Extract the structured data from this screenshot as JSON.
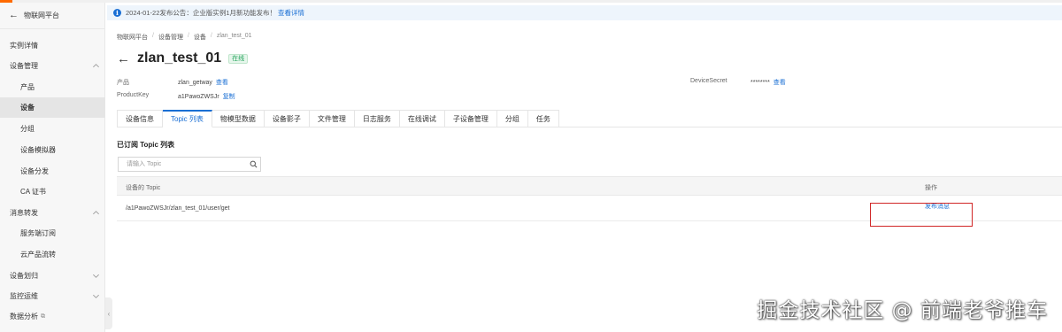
{
  "sidebar": {
    "back_label": "物联网平台",
    "items": [
      {
        "label": "实例详情"
      },
      {
        "label": "设备管理"
      },
      {
        "label": "产品"
      },
      {
        "label": "设备"
      },
      {
        "label": "分组"
      },
      {
        "label": "设备模拟器"
      },
      {
        "label": "设备分发"
      },
      {
        "label": "CA 证书"
      },
      {
        "label": "消息转发"
      },
      {
        "label": "服务端订阅"
      },
      {
        "label": "云产品流转"
      },
      {
        "label": "设备划归"
      },
      {
        "label": "监控运维"
      },
      {
        "label": "数据分析"
      }
    ]
  },
  "notice": {
    "text": "2024-01-22发布公告：企业版实例1月新功能发布！",
    "link": "查看详情"
  },
  "breadcrumb": [
    "物联网平台",
    "设备管理",
    "设备",
    "zlan_test_01"
  ],
  "page": {
    "title": "zlan_test_01",
    "status": "在线"
  },
  "meta": {
    "product_label": "产品",
    "product_value": "zlan_getway",
    "product_link": "查看",
    "productkey_label": "ProductKey",
    "productkey_value": "a1PawoZWSJr",
    "productkey_link": "复制",
    "secret_label": "DeviceSecret",
    "secret_value": "********",
    "secret_link": "查看"
  },
  "tabs": [
    "设备信息",
    "Topic 列表",
    "物模型数据",
    "设备影子",
    "文件管理",
    "日志服务",
    "在线调试",
    "子设备管理",
    "分组",
    "任务"
  ],
  "section_title": "已订阅 Topic 列表",
  "search": {
    "placeholder": "请输入 Topic"
  },
  "table": {
    "headers": [
      "设备的 Topic",
      "操作"
    ],
    "rows": [
      {
        "topic": "/a1PawoZWSJr/zlan_test_01/user/get",
        "action": "发布消息"
      }
    ]
  },
  "watermark": "掘金技术社区 @ 前端老爷推车",
  "colors": {
    "accent": "#1a6fd4",
    "brand": "#ff6a00",
    "highlight": "#d02525",
    "online": "#21a35a"
  }
}
